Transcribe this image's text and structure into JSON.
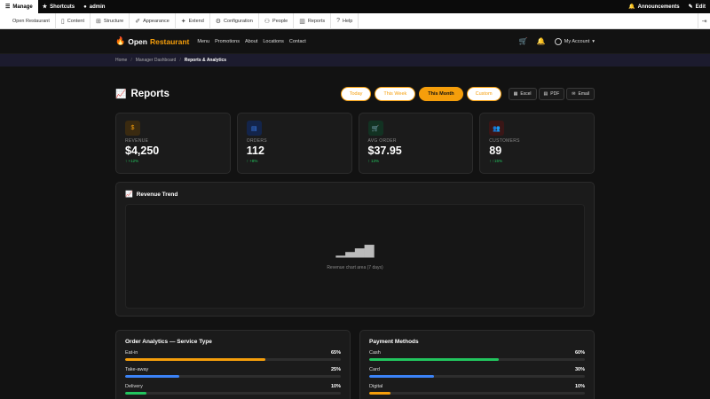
{
  "admin_toolbar": {
    "manage": "Manage",
    "shortcuts": "Shortcuts",
    "user": "admin",
    "announcements": "Announcements",
    "edit": "Edit"
  },
  "admin_menu": [
    {
      "label": "Open Restaurant",
      "icon": ""
    },
    {
      "label": "Content",
      "icon": "document-icon"
    },
    {
      "label": "Structure",
      "icon": "structure-icon"
    },
    {
      "label": "Appearance",
      "icon": "brush-icon"
    },
    {
      "label": "Extend",
      "icon": "puzzle-icon"
    },
    {
      "label": "Configuration",
      "icon": "wrench-icon"
    },
    {
      "label": "People",
      "icon": "people-icon"
    },
    {
      "label": "Reports",
      "icon": "bar-chart-icon"
    },
    {
      "label": "Help",
      "icon": "help-icon"
    }
  ],
  "header": {
    "brand_prefix": "Open ",
    "brand_accent": "Restaurant",
    "nav": [
      "Menu",
      "Promotions",
      "About",
      "Locations",
      "Contact"
    ],
    "account_label": "My Account"
  },
  "breadcrumb": [
    "Home",
    "Manager Dashboard",
    "Reports & Analytics"
  ],
  "page": {
    "title": "Reports",
    "ranges": [
      {
        "label": "Today",
        "active": false
      },
      {
        "label": "This Week",
        "active": false
      },
      {
        "label": "This Month",
        "active": true
      },
      {
        "label": "Custom",
        "active": false
      }
    ],
    "exports": [
      {
        "label": "Excel",
        "icon": "file-excel-icon"
      },
      {
        "label": "PDF",
        "icon": "file-pdf-icon"
      },
      {
        "label": "Email",
        "icon": "email-icon"
      }
    ]
  },
  "stats": [
    {
      "label": "REVENUE",
      "value": "$4,250",
      "change": "↑ +12%",
      "icon": "$",
      "color": "#f59e0b"
    },
    {
      "label": "ORDERS",
      "value": "112",
      "change": "↑ +8%",
      "icon": "▤",
      "color": "#3b82f6"
    },
    {
      "label": "AVG ORDER",
      "value": "$37.95",
      "change": "↑ 13%",
      "icon": "🛒",
      "color": "#22c55e"
    },
    {
      "label": "CUSTOMERS",
      "value": "89",
      "change": "↑ ↑15%",
      "icon": "👥",
      "color": "#ef4444"
    }
  ],
  "trend": {
    "title": "Revenue Trend",
    "placeholder": "Revenue chart area (7 days)"
  },
  "service_type": {
    "title": "Order Analytics — Service Type",
    "rows": [
      {
        "label": "Eat-in",
        "pct_label": "65%",
        "value": 65,
        "color": "#f59e0b"
      },
      {
        "label": "Take-away",
        "pct_label": "25%",
        "value": 25,
        "color": "#3b82f6"
      },
      {
        "label": "Delivery",
        "pct_label": "10%",
        "value": 10,
        "color": "#22c55e"
      }
    ]
  },
  "payment": {
    "title": "Payment Methods",
    "rows": [
      {
        "label": "Cash",
        "pct_label": "60%",
        "value": 60,
        "color": "#22c55e"
      },
      {
        "label": "Card",
        "pct_label": "30%",
        "value": 30,
        "color": "#3b82f6"
      },
      {
        "label": "Digital",
        "pct_label": "10%",
        "value": 10,
        "color": "#f59e0b"
      }
    ]
  }
}
